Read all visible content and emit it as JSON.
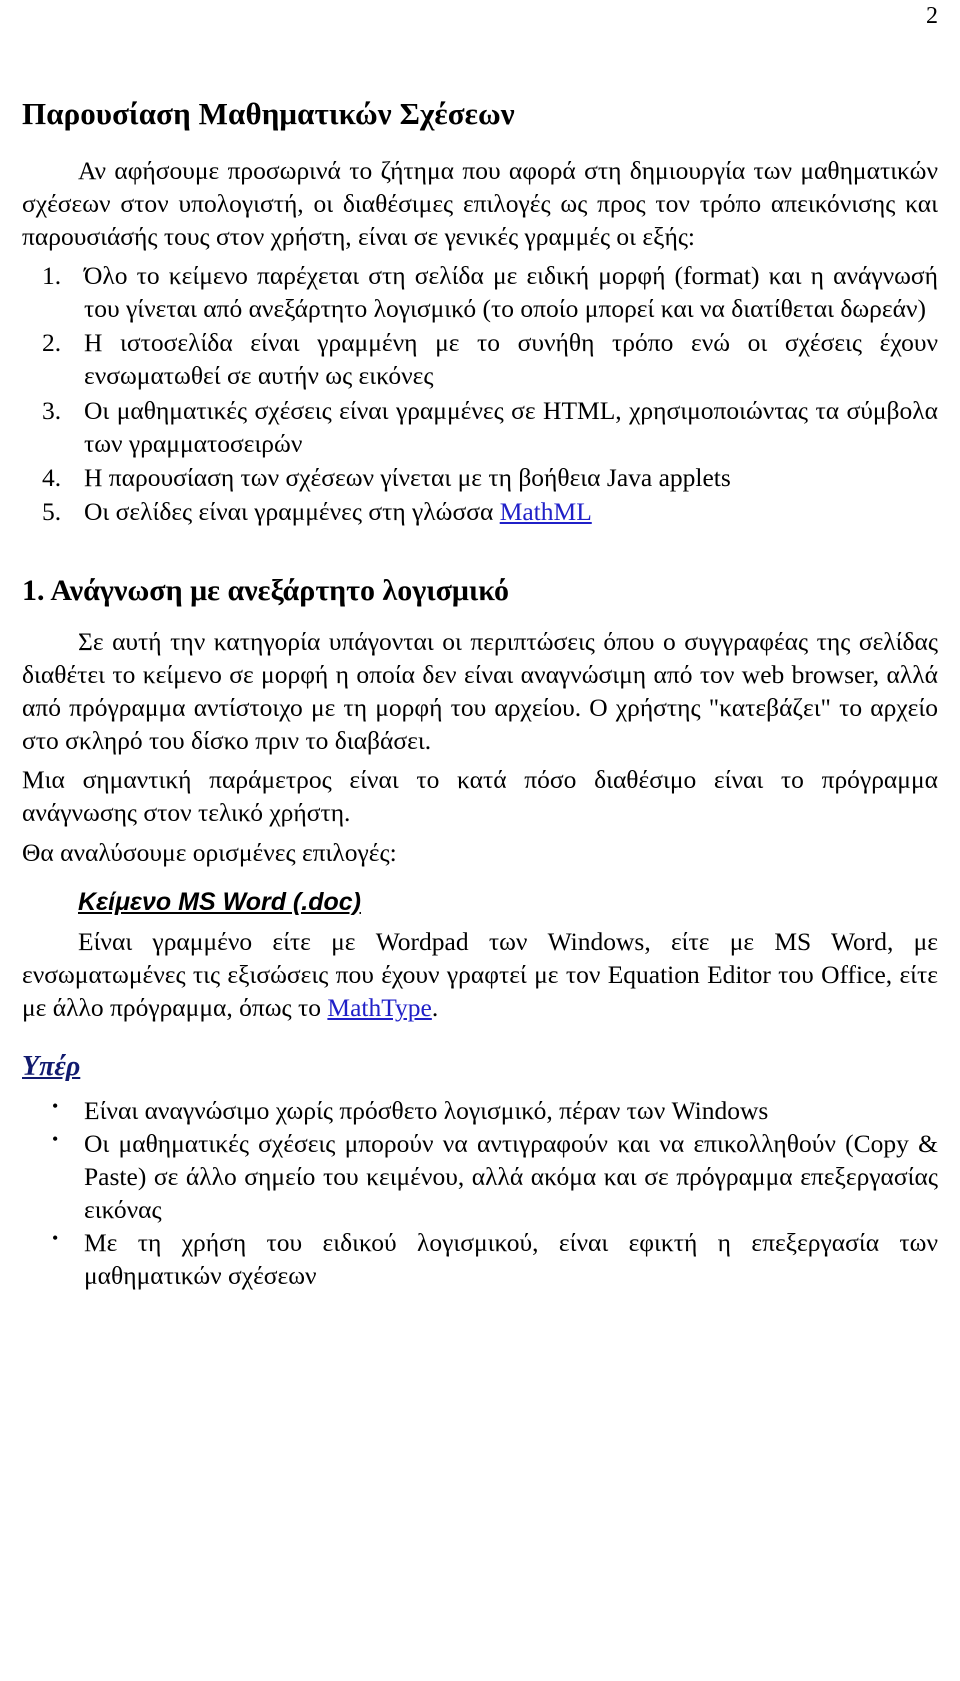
{
  "page": {
    "number": "2",
    "title": "Παρουσίαση Μαθηματικών Σχέσεων",
    "link_color": "#2020c8",
    "heading_blue_color": "#111a6e",
    "text_color": "#000000",
    "background_color": "#ffffff"
  },
  "intro": {
    "paragraph": "Αν αφήσουμε προσωρινά το ζήτημα που αφορά στη δημιουργία των μαθηματικών σχέσεων στον υπολογιστή, οι διαθέσιμες επιλογές ως προς τον τρόπο απεικόνισης και παρουσιάσής τους στον χρήστη, είναι σε γενικές γραμμές οι εξής:"
  },
  "numbered_list": {
    "items": [
      {
        "number": "1.",
        "text": "Όλο το κείμενο παρέχεται στη σελίδα με ειδική μορφή (format) και η ανάγνωσή του γίνεται από ανεξάρτητο λογισμικό (το οποίο μπορεί και να διατίθεται δωρεάν)"
      },
      {
        "number": "2.",
        "text": "Η ιστοσελίδα είναι γραμμένη με το συνήθη τρόπο ενώ οι σχέσεις έχουν ενσωματωθεί σε αυτήν ως εικόνες"
      },
      {
        "number": "3.",
        "text": "Οι μαθηματικές σχέσεις είναι γραμμένες σε HTML, χρησιμοποιώντας τα σύμβολα των γραμματοσειρών"
      },
      {
        "number": "4.",
        "text": "Η παρουσίαση των σχέσεων γίνεται με τη βοήθεια Java applets"
      },
      {
        "number": "5.",
        "text_before": "Οι σελίδες είναι γραμμένες στη γλώσσα ",
        "link": "MathML",
        "text_after": ""
      }
    ]
  },
  "section1": {
    "heading": "1. Ανάγνωση με ανεξάρτητο λογισμικό",
    "paragraph1": "Σε αυτή την κατηγορία υπάγονται οι περιπτώσεις όπου ο συγγραφέας της σελίδας διαθέτει το κείμενο σε μορφή η οποία δεν είναι αναγνώσιμη από τον web browser, αλλά από πρόγραμμα αντίστοιχο με τη μορφή του αρχείου. Ο χρήστης \"κατεβάζει\" το αρχείο στο σκληρό του δίσκο πριν το διαβάσει.",
    "paragraph2": "Μια σημαντική παράμετρος είναι το κατά πόσο διαθέσιμο είναι το πρόγραμμα ανάγνωσης στον τελικό χρήστη.",
    "paragraph3": "Θα αναλύσουμε ορισμένες επιλογές:"
  },
  "subsection_doc": {
    "heading": "Κείμενο MS Word (.doc)",
    "paragraph_before_link": "Είναι γραμμένο είτε με Wordpad των Windows, είτε με MS Word, με ενσωματωμένες τις εξισώσεις που έχουν γραφτεί με τον Equation Editor του Office, είτε με άλλο πρόγραμμα, όπως το ",
    "link": "MathType",
    "paragraph_after_link": "."
  },
  "pros": {
    "heading": "Υπέρ",
    "items": [
      "Είναι αναγνώσιμο χωρίς πρόσθετο λογισμικό, πέραν των Windows",
      "Οι μαθηματικές σχέσεις μπορούν να αντιγραφούν και να επικολληθούν (Copy & Paste) σε άλλο σημείο του κειμένου, αλλά ακόμα και σε πρόγραμμα επεξεργασίας εικόνας",
      "Με τη χρήση του ειδικού λογισμικού, είναι εφικτή η επεξεργασία των μαθηματικών σχέσεων"
    ]
  }
}
